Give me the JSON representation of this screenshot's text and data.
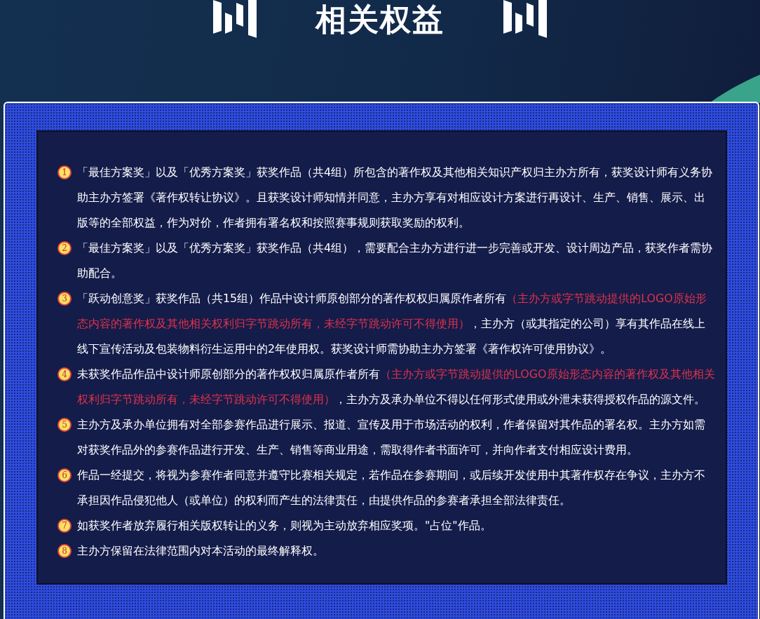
{
  "header": {
    "title": "相关权益"
  },
  "items": [
    {
      "number": "1",
      "segments": [
        {
          "text": "「最佳方案奖」以及「优秀方案奖」获奖作品（共4组）所包含的著作权及其他相关知识产权归主办方所有，获奖设计师有义务协助主办方签署《著作权转让协议》。且获奖设计师知情并同意，主办方享有对相应设计方案进行再设计、生产、销售、展示、出版等的全部权益，作为对价，作者拥有署名权和按照赛事规则获取奖励的权利。",
          "emphasis": false
        }
      ]
    },
    {
      "number": "2",
      "segments": [
        {
          "text": "「最佳方案奖」以及「优秀方案奖」获奖作品（共4组），需要配合主办方进行进一步完善或开发、设计周边产品，获奖作者需协助配合。",
          "emphasis": false
        }
      ]
    },
    {
      "number": "3",
      "segments": [
        {
          "text": "「跃动创意奖」获奖作品（共15组）作品中设计师原创部分的著作权权归属原作者所有",
          "emphasis": false
        },
        {
          "text": "（主办方或字节跳动提供的LOGO原始形态内容的著作权及其他相关权利归字节跳动所有，未经字节跳动许可不得使用）",
          "emphasis": true
        },
        {
          "text": "，主办方（或其指定的公司）享有其作品在线上线下宣传活动及包装物料衍生运用中的2年使用权。获奖设计师需协助主办方签署《著作权许可使用协议》。",
          "emphasis": false
        }
      ]
    },
    {
      "number": "4",
      "segments": [
        {
          "text": "未获奖作品作品中设计师原创部分的著作权权归属原作者所有",
          "emphasis": false
        },
        {
          "text": "（主办方或字节跳动提供的LOGO原始形态内容的著作权及其他相关权利归字节跳动所有，未经字节跳动许可不得使用）",
          "emphasis": true
        },
        {
          "text": "，主办方及承办单位不得以任何形式使用或外泄未获得授权作品的源文件。",
          "emphasis": false
        }
      ]
    },
    {
      "number": "5",
      "segments": [
        {
          "text": "主办方及承办单位拥有对全部参赛作品进行展示、报道、宣传及用于市场活动的权利，作者保留对其作品的署名权。主办方如需对获奖作品外的参赛作品进行开发、生产、销售等商业用途，需取得作者书面许可，并向作者支付相应设计费用。",
          "emphasis": false
        }
      ]
    },
    {
      "number": "6",
      "segments": [
        {
          "text": "作品一经提交，将视为参赛作者同意并遵守比赛相关规定，若作品在参赛期间，或后续开发使用中其著作权存在争议，主办方不承担因作品侵犯他人（或单位）的权利而产生的法律责任，由提供作品的参赛者承担全部法律责任。",
          "emphasis": false
        }
      ]
    },
    {
      "number": "7",
      "segments": [
        {
          "text": "如获奖作者放弃履行相关版权转让的义务，则视为主动放弃相应奖项。\"占位\"作品。",
          "emphasis": false
        }
      ]
    },
    {
      "number": "8",
      "segments": [
        {
          "text": "主办方保留在法律范围内对本活动的最终解释权。",
          "emphasis": false
        }
      ]
    }
  ]
}
